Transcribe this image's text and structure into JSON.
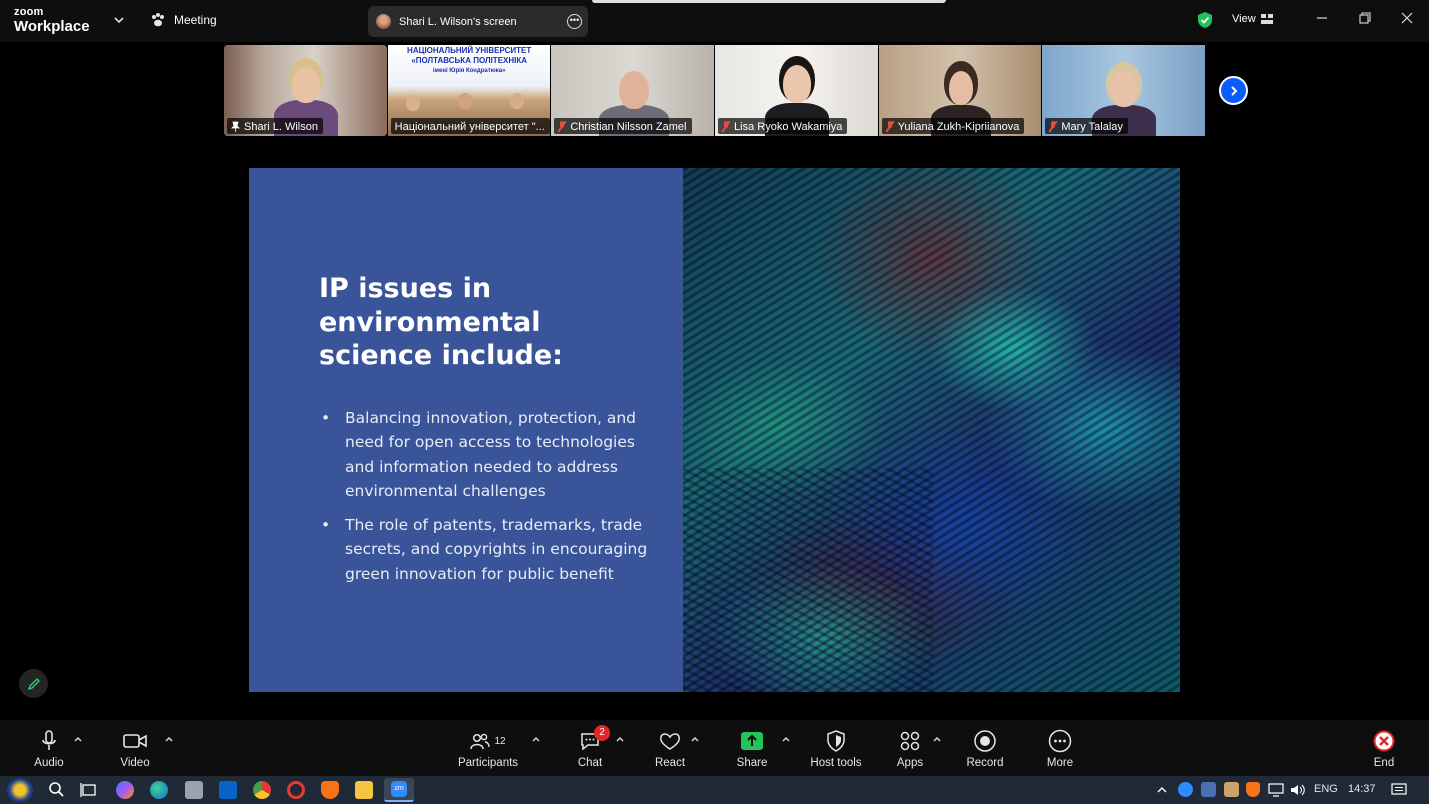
{
  "app": {
    "logo_line1": "zoom",
    "logo_line2": "Workplace",
    "meeting_label": "Meeting",
    "shared_screen_label": "Shari  L. Wilson's screen",
    "view_label": "View"
  },
  "participants": [
    {
      "name": "Shari  L. Wilson",
      "pinned": true,
      "muted": false,
      "active": true
    },
    {
      "name": "Національний університет \"...",
      "pinned": false,
      "muted": false,
      "active": false
    },
    {
      "name": "Christian Nilsson Zamel",
      "pinned": false,
      "muted": true,
      "active": false
    },
    {
      "name": "Lisa Ryoko Wakamiya",
      "pinned": false,
      "muted": true,
      "active": false
    },
    {
      "name": "Yuliana Zukh-Kipriianova",
      "pinned": false,
      "muted": true,
      "active": false
    },
    {
      "name": "Mary Talalay",
      "pinned": false,
      "muted": true,
      "active": false
    }
  ],
  "thumb_banner": {
    "line1": "НАЦІОНАЛЬНИЙ УНІВЕРСИТЕТ",
    "line2": "«ПОЛТАВСЬКА ПОЛІТЕХНІКА",
    "line3": "імені Юрія Кондратюка»"
  },
  "slide": {
    "title": "IP issues in environmental science include:",
    "bullets": [
      "Balancing innovation, protection, and need for open access to technologies and information needed to address environmental challenges",
      "The role of patents, trademarks, trade secrets, and copyrights in encouraging green innovation for public benefit"
    ],
    "left_color": "#3a549a"
  },
  "toolbar": {
    "audio": "Audio",
    "video": "Video",
    "participants": "Participants",
    "participants_count": "12",
    "chat": "Chat",
    "chat_badge": "2",
    "react": "React",
    "share": "Share",
    "host_tools": "Host tools",
    "apps": "Apps",
    "record": "Record",
    "more": "More",
    "end": "End"
  },
  "taskbar": {
    "language": "ENG",
    "time": "14:37"
  },
  "colors": {
    "active_outline": "#2bd77b",
    "share_green": "#21c35a",
    "end_red": "#e02828",
    "next_blue": "#0b5cff"
  }
}
